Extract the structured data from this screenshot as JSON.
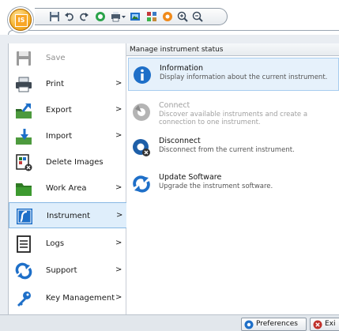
{
  "app": {
    "orb_label": "IS"
  },
  "quick_access": {
    "buttons": [
      {
        "icon": "save-icon"
      },
      {
        "icon": "undo-icon"
      },
      {
        "icon": "redo-icon"
      },
      {
        "icon": "stop-icon"
      },
      {
        "icon": "print-dropdown-icon"
      },
      {
        "icon": "image-icon"
      },
      {
        "icon": "grid-icon"
      },
      {
        "icon": "circle-icon"
      },
      {
        "icon": "zoom-in-icon"
      },
      {
        "icon": "zoom-out-icon"
      }
    ]
  },
  "menu": {
    "items": [
      {
        "label": "Save",
        "icon": "save-icon",
        "arrow": "",
        "disabled": true
      },
      {
        "label": "Print",
        "icon": "printer-icon",
        "arrow": ">",
        "disabled": false
      },
      {
        "label": "Export",
        "icon": "export-icon",
        "arrow": ">",
        "disabled": false
      },
      {
        "label": "Import",
        "icon": "import-icon",
        "arrow": ">",
        "disabled": false
      },
      {
        "label": "Delete Images",
        "icon": "delete-images-icon",
        "arrow": "",
        "disabled": false
      },
      {
        "label": "Work Area",
        "icon": "folder-icon",
        "arrow": ">",
        "disabled": false
      },
      {
        "label": "Instrument",
        "icon": "instrument-icon",
        "arrow": ">",
        "disabled": false,
        "selected": true
      },
      {
        "label": "Logs",
        "icon": "log-icon",
        "arrow": ">",
        "disabled": false
      },
      {
        "label": "Support",
        "icon": "support-icon",
        "arrow": ">",
        "disabled": false
      },
      {
        "label": "Key Management",
        "icon": "key-icon",
        "arrow": ">",
        "disabled": false
      }
    ]
  },
  "content": {
    "header": "Manage instrument status",
    "options": [
      {
        "title": "Information",
        "description": "Display information about the current instrument.",
        "icon": "info-icon",
        "disabled": false,
        "highlight": true
      },
      {
        "title": "Connect",
        "description": "Discover available instruments and create a connection to one instrument.",
        "icon": "connect-icon",
        "disabled": true
      },
      {
        "title": "Disconnect",
        "description": "Disconnect from the current instrument.",
        "icon": "disconnect-icon",
        "disabled": false
      },
      {
        "title": "Update Software",
        "description": "Upgrade the instrument software.",
        "icon": "update-icon",
        "disabled": false
      }
    ]
  },
  "footer": {
    "preferences_label": "Preferences",
    "exit_label": "Exi"
  },
  "colors": {
    "accent": "#1e6fc8",
    "selected_bg": "#dfeefb",
    "orb": "#f5b432"
  }
}
